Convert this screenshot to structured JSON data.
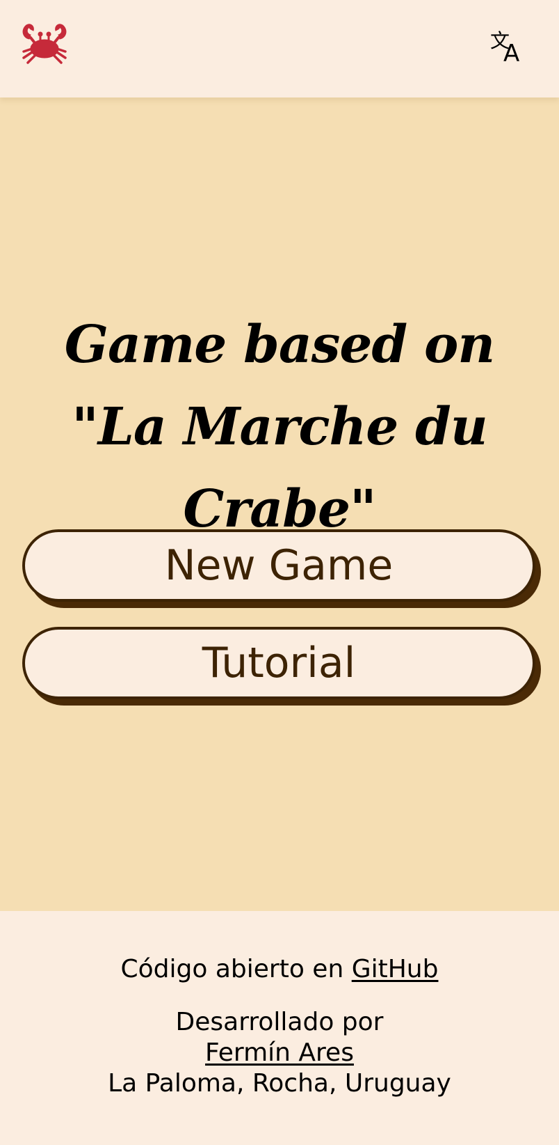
{
  "header": {
    "logo_icon": "crab-icon",
    "translate_icon": "translate-icon",
    "logo_color": "#c62a3a"
  },
  "main": {
    "title": "Game based on \"La Marche du Crabe\"",
    "new_game_label": "New Game",
    "tutorial_label": "Tutorial"
  },
  "footer": {
    "source_prefix": "Código abierto en ",
    "source_link": "GitHub",
    "developed_by": "Desarrollado por",
    "author_link": "Fermín Ares",
    "location": "La Paloma, Rocha, Uruguay"
  },
  "colors": {
    "header_bg": "#fbede0",
    "main_bg": "#f5deb3",
    "button_border": "#3d2304",
    "button_bg": "#fbede0"
  }
}
